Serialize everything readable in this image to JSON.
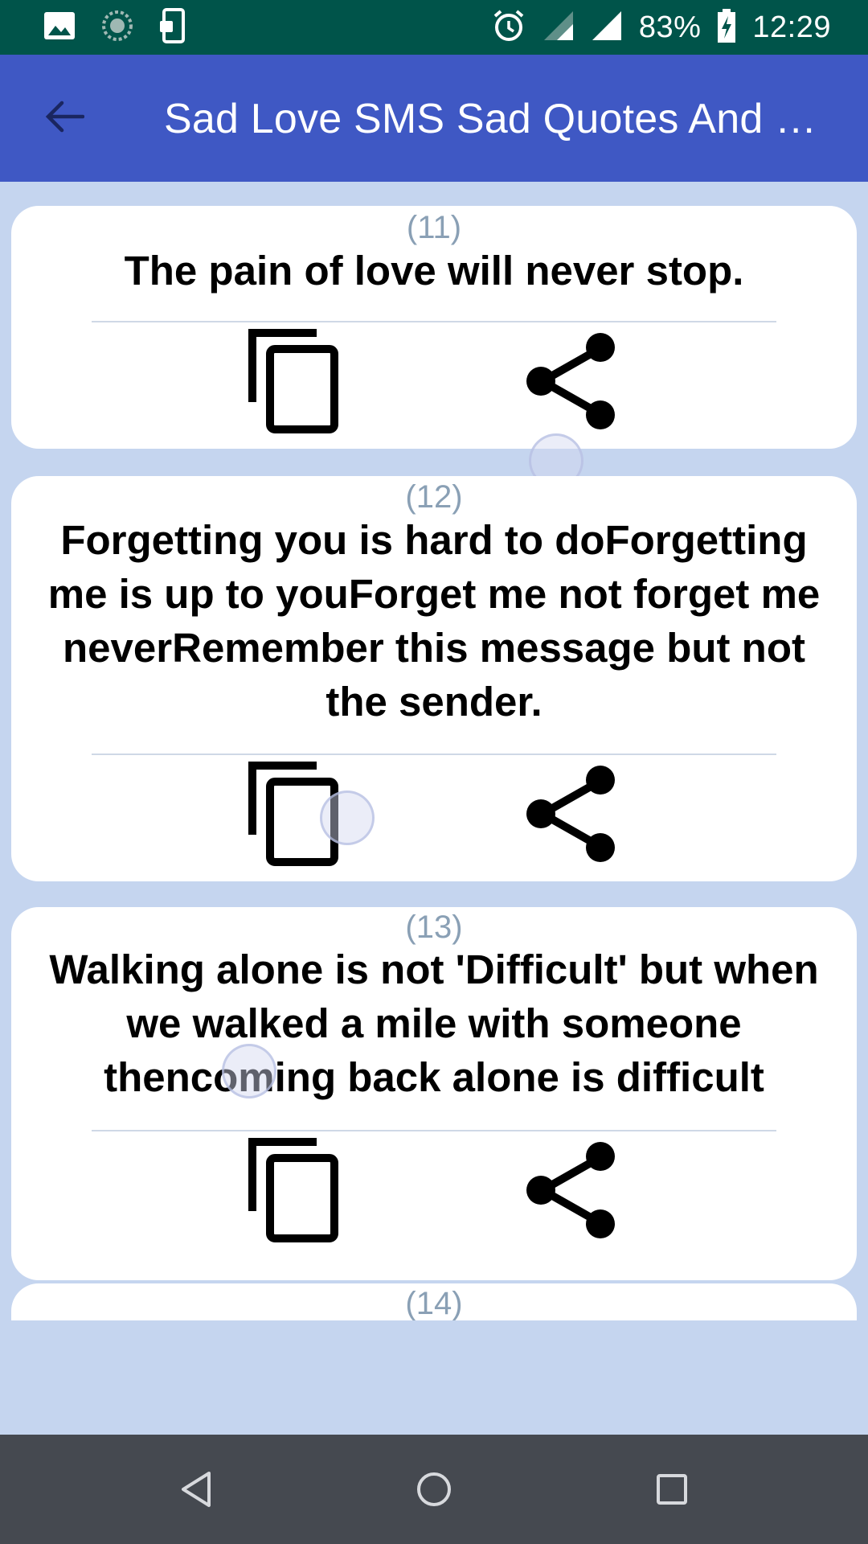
{
  "status_bar": {
    "battery": "83%",
    "time": "12:29",
    "icons": [
      "image-icon",
      "sync-icon",
      "phone-lock-icon",
      "alarm-icon",
      "signal-icon",
      "signal-icon",
      "battery-charging-icon"
    ]
  },
  "app_bar": {
    "back_icon": "arrow-back-icon",
    "title": "Sad Love SMS Sad Quotes And Poetry"
  },
  "quotes": [
    {
      "number": "(11)",
      "text": "The pain of love will never stop."
    },
    {
      "number": "(12)",
      "text": "Forgetting you is hard to doForgetting me is up to youForget me not forget me neverRemember this message but not the sender."
    },
    {
      "number": "(13)",
      "text": "Walking alone is not 'Difficult' but when we walked a mile with someone thencoming back alone is difficult"
    },
    {
      "number": "(14)",
      "text": ""
    }
  ],
  "actions": {
    "copy_icon": "copy-icon",
    "share_icon": "share-icon"
  },
  "nav_bar": {
    "icons": [
      "back-triangle-icon",
      "home-circle-icon",
      "recents-square-icon"
    ]
  },
  "colors": {
    "status_bar": "#00544a",
    "app_bar": "#3f58c4",
    "background": "#c5d5ef",
    "card": "#ffffff",
    "number": "#8aa0b5",
    "nav_bar": "#454950"
  }
}
